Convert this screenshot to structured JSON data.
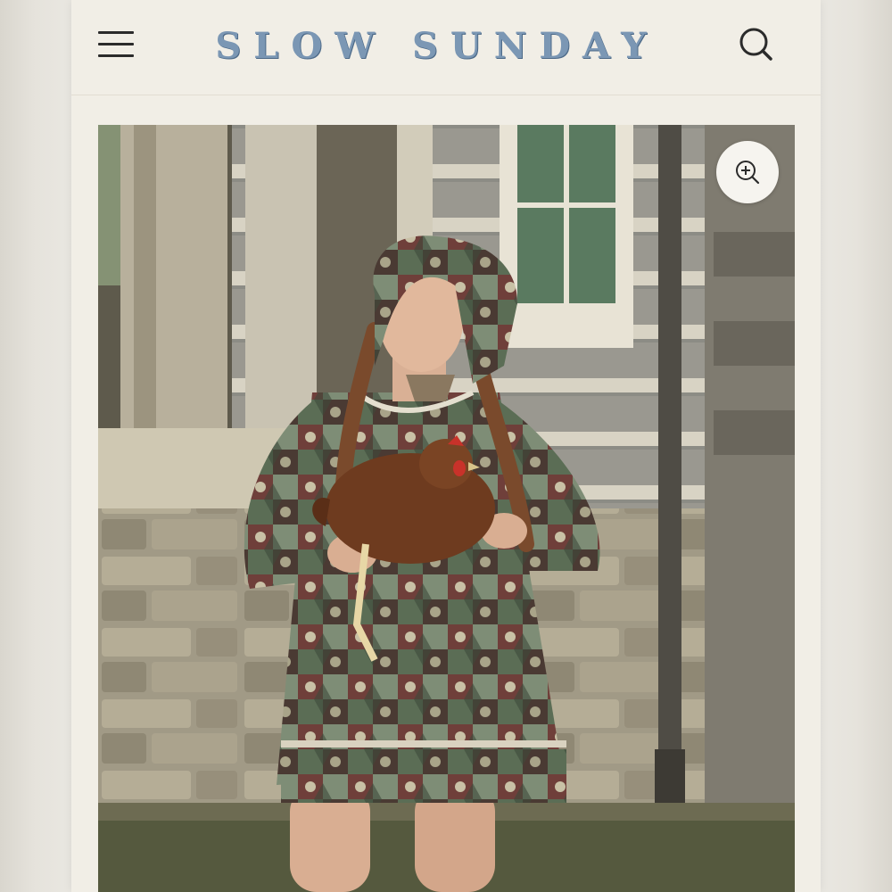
{
  "header": {
    "logo_text": "SLOW SUNDAY",
    "menu_icon": "hamburger-menu-icon",
    "search_icon": "search-icon"
  },
  "product_image": {
    "zoom_icon": "zoom-in-icon"
  },
  "colors": {
    "background": "#f1eee6",
    "logo": "#7b97b4",
    "icon": "#2b2b2b"
  }
}
